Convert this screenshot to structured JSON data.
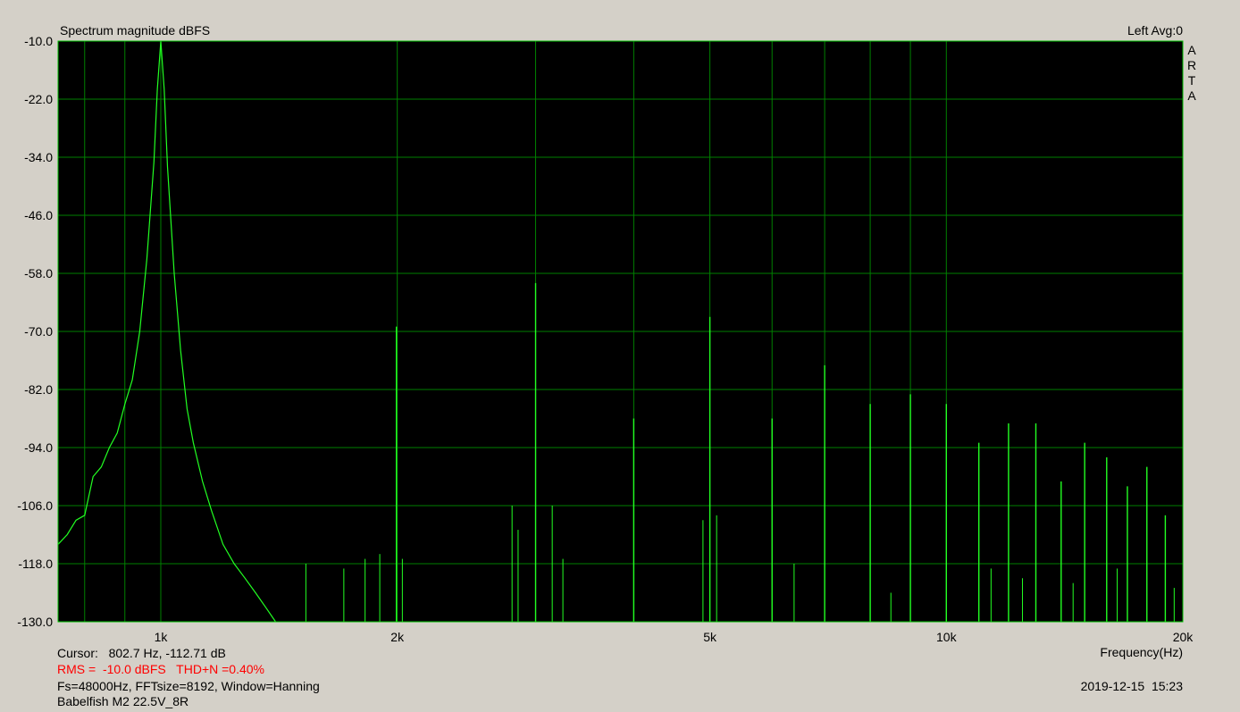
{
  "chart_data": {
    "type": "line",
    "title": "Spectrum magnitude dBFS",
    "channel_label": "Left  Avg:0",
    "brand_letters": [
      "A",
      "R",
      "T",
      "A"
    ],
    "xlabel": "Frequency(Hz)",
    "x_scale": "log",
    "xlim": [
      740,
      20000
    ],
    "ylim": [
      -130,
      -10
    ],
    "y_ticks": [
      -10.0,
      -22.0,
      -34.0,
      -46.0,
      -58.0,
      -70.0,
      -82.0,
      -94.0,
      -106.0,
      -118.0,
      -130.0
    ],
    "y_tick_labels": [
      "-10.0",
      "-22.0",
      "-34.0",
      "-46.0",
      "-58.0",
      "-70.0",
      "-82.0",
      "-94.0",
      "-106.0",
      "-118.0",
      "-130.0"
    ],
    "x_ticks": [
      1000,
      2000,
      5000,
      10000,
      20000
    ],
    "x_tick_labels": [
      "1k",
      "2k",
      "5k",
      "10k",
      "20k"
    ],
    "x_grid_values": [
      800,
      900,
      1000,
      2000,
      3000,
      4000,
      5000,
      6000,
      7000,
      8000,
      9000,
      10000,
      20000
    ],
    "grid": true,
    "colors": {
      "plot_background": "#000000",
      "grid": "#008000",
      "trace": "#22ff22",
      "frame": "#00c000",
      "rms_text": "#ff0000"
    },
    "series": [
      {
        "x": [
          740,
          760,
          780,
          800,
          820,
          840,
          860,
          880,
          900,
          920,
          940,
          960,
          980,
          990,
          1000,
          1010,
          1020,
          1040,
          1060,
          1080,
          1100,
          1130,
          1160,
          1200,
          1240,
          1280,
          1320,
          1360,
          1400
        ],
        "y": [
          -114,
          -112,
          -109,
          -108,
          -100,
          -98,
          -94,
          -91,
          -85,
          -80,
          -70,
          -55,
          -35,
          -20,
          -10,
          -20,
          -36,
          -58,
          -74,
          -86,
          -93,
          -101,
          -107,
          -114,
          -118,
          -121,
          -124,
          -127,
          -130
        ]
      }
    ],
    "harmonic_peaks": [
      {
        "x": 1995,
        "y": -69
      },
      {
        "x": 3000,
        "y": -60
      },
      {
        "x": 4000,
        "y": -88
      },
      {
        "x": 5000,
        "y": -67
      },
      {
        "x": 6000,
        "y": -88
      },
      {
        "x": 7000,
        "y": -77
      },
      {
        "x": 8000,
        "y": -85
      },
      {
        "x": 9000,
        "y": -83
      },
      {
        "x": 10000,
        "y": -85
      },
      {
        "x": 11000,
        "y": -93
      },
      {
        "x": 12000,
        "y": -89
      },
      {
        "x": 13000,
        "y": -89
      },
      {
        "x": 14000,
        "y": -101
      },
      {
        "x": 15000,
        "y": -93
      },
      {
        "x": 16000,
        "y": -96
      },
      {
        "x": 17000,
        "y": -102
      },
      {
        "x": 18000,
        "y": -98
      },
      {
        "x": 19000,
        "y": -108
      }
    ],
    "spurs": [
      {
        "x": 1530,
        "y": -118
      },
      {
        "x": 1710,
        "y": -119
      },
      {
        "x": 1820,
        "y": -117
      },
      {
        "x": 1900,
        "y": -116
      },
      {
        "x": 2030,
        "y": -117
      },
      {
        "x": 2800,
        "y": -106
      },
      {
        "x": 2850,
        "y": -111
      },
      {
        "x": 3150,
        "y": -106
      },
      {
        "x": 3250,
        "y": -117
      },
      {
        "x": 4900,
        "y": -109
      },
      {
        "x": 5100,
        "y": -108
      },
      {
        "x": 6400,
        "y": -118
      },
      {
        "x": 8500,
        "y": -124
      },
      {
        "x": 11400,
        "y": -119
      },
      {
        "x": 12500,
        "y": -121
      },
      {
        "x": 14500,
        "y": -122
      },
      {
        "x": 16500,
        "y": -119
      },
      {
        "x": 19500,
        "y": -123
      }
    ]
  },
  "footer": {
    "cursor": "Cursor:   802.7 Hz, -112.71 dB",
    "rms": "RMS =  -10.0 dBFS   THD+N =0.40%",
    "params": "Fs=48000Hz, FFTsize=8192, Window=Hanning",
    "device": "Babelfish M2 22.5V_8R",
    "datetime": "2019-12-15  15:23"
  }
}
